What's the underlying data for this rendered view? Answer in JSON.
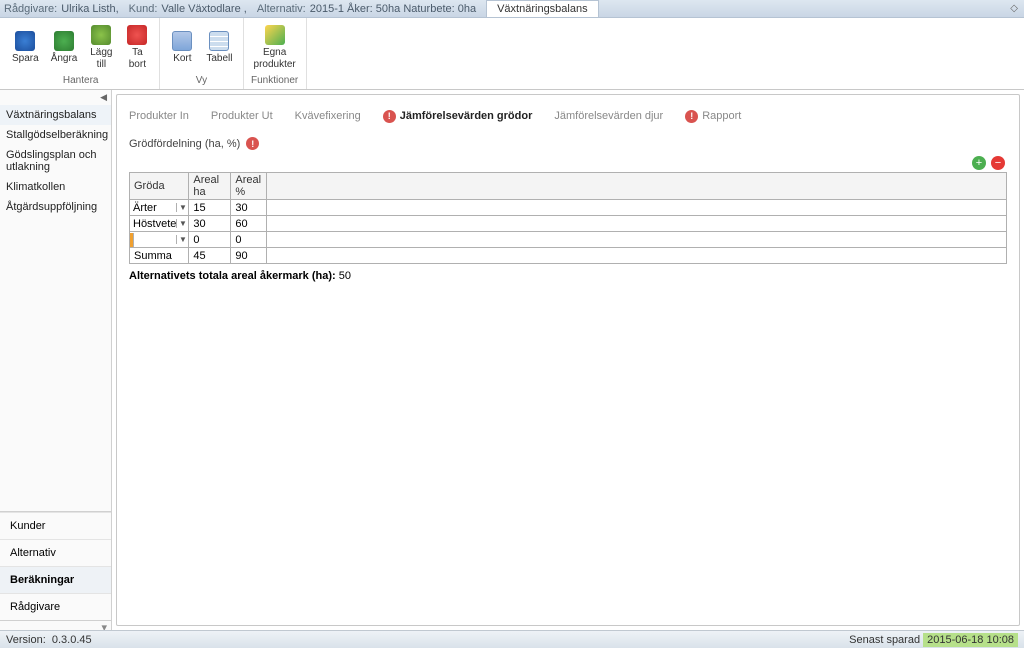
{
  "titlebar": {
    "radgivare_label": "Rådgivare:",
    "radgivare_val": "Ulrika Listh,",
    "kund_label": "Kund:",
    "kund_val": "Valle Växtodlare ,",
    "alt_label": "Alternativ:",
    "alt_val": "2015-1 Åker: 50ha Naturbete: 0ha",
    "active_tab": "Växtnäringsbalans"
  },
  "ribbon": {
    "spara": "Spara",
    "angra": "Ångra",
    "lagg_till": "Lägg\ntill",
    "ta_bort": "Ta\nbort",
    "hantera": "Hantera",
    "kort": "Kort",
    "tabell": "Tabell",
    "vy": "Vy",
    "egna_prod": "Egna\nprodukter",
    "funktioner": "Funktioner"
  },
  "sidebar": {
    "top": [
      {
        "label": "Växtnäringsbalans",
        "name": "sidebar-item-vaxtnaring",
        "active": true
      },
      {
        "label": "Stallgödselberäkning",
        "name": "sidebar-item-stallgodsel"
      },
      {
        "label": "Gödslingsplan och utlakning",
        "name": "sidebar-item-godslingsplan"
      },
      {
        "label": "Klimatkollen",
        "name": "sidebar-item-klimat"
      },
      {
        "label": "Åtgärdsuppföljning",
        "name": "sidebar-item-atgard"
      }
    ],
    "bottom": [
      {
        "label": "Kunder",
        "name": "sidebar-section-kunder"
      },
      {
        "label": "Alternativ",
        "name": "sidebar-section-alternativ"
      },
      {
        "label": "Beräkningar",
        "name": "sidebar-section-berakningar",
        "active": true
      },
      {
        "label": "Rådgivare",
        "name": "sidebar-section-radgivare"
      }
    ]
  },
  "tabs": [
    {
      "label": "Produkter In",
      "warn": false,
      "active": false,
      "name": "tab-produkter-in"
    },
    {
      "label": "Produkter Ut",
      "warn": false,
      "active": false,
      "name": "tab-produkter-ut"
    },
    {
      "label": "Kvävefixering",
      "warn": false,
      "active": false,
      "name": "tab-kvavefixering"
    },
    {
      "label": "Jämförelsevärden grödor",
      "warn": true,
      "active": true,
      "name": "tab-jamforelse-grodor"
    },
    {
      "label": "Jämförelsevärden djur",
      "warn": false,
      "active": false,
      "name": "tab-jamforelse-djur"
    },
    {
      "label": "Rapport",
      "warn": true,
      "active": false,
      "name": "tab-rapport"
    }
  ],
  "subhead": "Grödfördelning (ha, %)",
  "table": {
    "headers": {
      "groda": "Gröda",
      "arealha": "Areal ha",
      "arealp": "Areal %"
    },
    "rows": [
      {
        "groda": "Ärter",
        "arealha": "15",
        "arealp": "30",
        "sel": false
      },
      {
        "groda": "Höstvete",
        "arealha": "30",
        "arealp": "60",
        "sel": false
      },
      {
        "groda": "",
        "arealha": "0",
        "arealp": "0",
        "sel": true
      }
    ],
    "sum_label": "Summa",
    "sum_ha": "45",
    "sum_p": "90"
  },
  "totals_label": "Alternativets totala areal åkermark (ha):",
  "totals_val": "50",
  "status": {
    "version_label": "Version:",
    "version_val": "0.3.0.45",
    "saved_label": "Senast sparad",
    "saved_val": "2015-06-18 10:08"
  },
  "chart_data": {
    "type": "table",
    "title": "Grödfördelning (ha, %)",
    "columns": [
      "Gröda",
      "Areal ha",
      "Areal %"
    ],
    "rows": [
      [
        "Ärter",
        15,
        30
      ],
      [
        "Höstvete",
        30,
        60
      ],
      [
        "",
        0,
        0
      ]
    ],
    "summary": {
      "label": "Summa",
      "Areal ha": 45,
      "Areal %": 90
    },
    "total_aker_ha": 50
  }
}
